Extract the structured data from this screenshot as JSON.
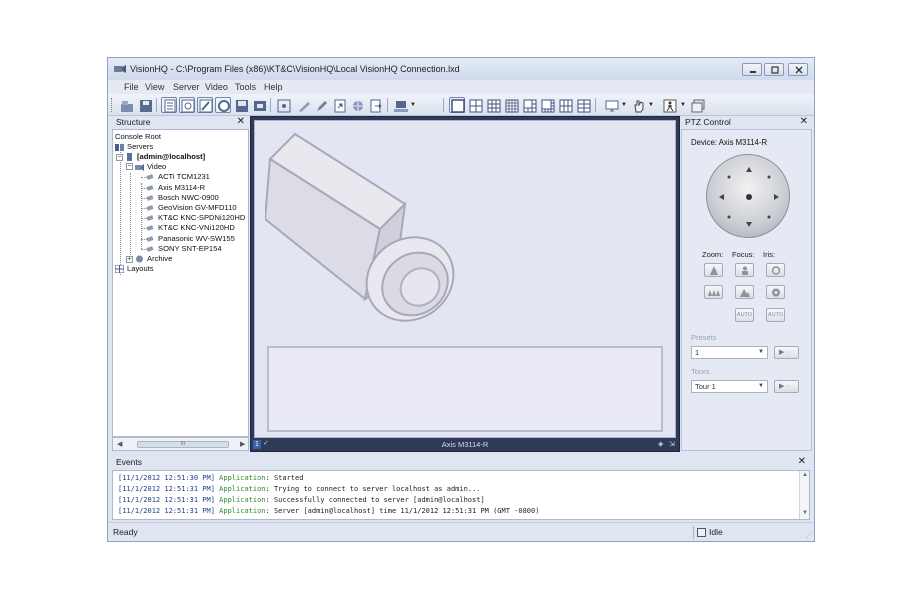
{
  "window": {
    "title": "VisionHQ - C:\\Program Files (x86)\\KT&C\\VisionHQ\\Local VisionHQ Connection.lxd"
  },
  "menu": [
    "File",
    "View",
    "Server",
    "Video",
    "Tools",
    "Help"
  ],
  "toolbar": {
    "buttons": [
      "open-icon",
      "save-icon",
      "page-icon",
      "preview-icon",
      "edit-icon",
      "record-icon",
      "disk-icon",
      "stop-icon",
      "fullscreen-icon",
      "draw-icon",
      "pencil-icon",
      "export-icon",
      "web-icon",
      "document-icon",
      "computer-icon",
      "layout-1x1-icon",
      "layout-2x2-icon",
      "layout-3x3-icon",
      "layout-4x4-icon",
      "layout-1plus5-icon",
      "layout-1plus7-icon",
      "layout-3x4-icon",
      "layout-4x3-icon",
      "monitor-icon",
      "hand-icon",
      "person-icon",
      "window-icon"
    ]
  },
  "structure": {
    "title": "Structure",
    "root": "Console Root",
    "servers": "Servers",
    "server": "[admin@localhost]",
    "video": "Video",
    "cameras": [
      "ACTi TCM1231",
      "Axis M3114-R",
      "Bosch NWC-0900",
      "GeoVision GV-MFD110",
      "KT&C KNC-SPDNi120HD",
      "KT&C KNC-VNi120HD",
      "Panasonic WV-SW155",
      "SONY SNT-EP154"
    ],
    "archive": "Archive",
    "layouts": "Layouts",
    "scroll_thumb": "III"
  },
  "video": {
    "slot_number": "1",
    "camera_label": "Axis M3114-R"
  },
  "ptz": {
    "title": "PTZ Control",
    "device": "Device: Axis M3114-R",
    "zoom_label": "Zoom:",
    "focus_label": "Focus:",
    "iris_label": "Iris:",
    "auto_label": "AUTO",
    "presets_label": "Presets",
    "preset_value": "1",
    "tours_label": "Tours",
    "tour_value": "Tour 1"
  },
  "events": {
    "title": "Events",
    "entries": [
      {
        "time": "[11/1/2012 12:51:30 PM]",
        "source": "Application",
        "message": ": Started"
      },
      {
        "time": "[11/1/2012 12:51:31 PM]",
        "source": "Application",
        "message": ": Trying to connect to server localhost as admin..."
      },
      {
        "time": "[11/1/2012 12:51:31 PM]",
        "source": "Application",
        "message": ": Successfully connected to server [admin@localhost]"
      },
      {
        "time": "[11/1/2012 12:51:31 PM]",
        "source": "Application",
        "message": ": Server [admin@localhost] time 11/1/2012 12:51:31 PM (GMT -0800)"
      }
    ]
  },
  "status": {
    "left": "Ready",
    "right": "Idle"
  }
}
